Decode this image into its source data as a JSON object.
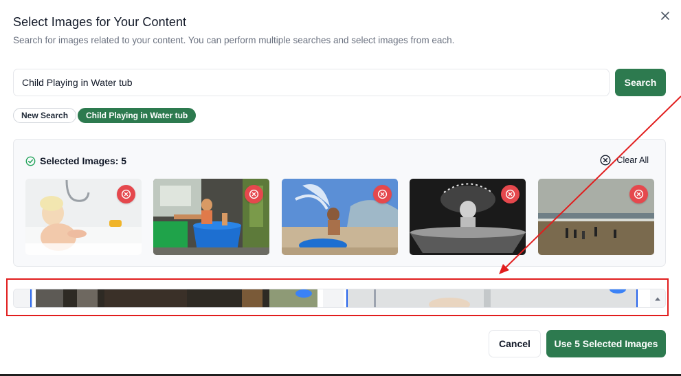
{
  "dialog": {
    "title": "Select Images for Your Content",
    "subtitle": "Search for images related to your content. You can perform multiple searches and select images from each.",
    "close_icon": "close-icon"
  },
  "search": {
    "value": "Child Playing in Water tub",
    "button_label": "Search"
  },
  "chips": {
    "new_search": "New Search",
    "active_query": "Child Playing in Water tub"
  },
  "selected": {
    "title": "Selected Images: 5",
    "clear_all_label": "Clear All",
    "images": [
      {
        "icon": "remove-icon"
      },
      {
        "icon": "remove-icon"
      },
      {
        "icon": "remove-icon"
      },
      {
        "icon": "remove-icon"
      },
      {
        "icon": "remove-icon"
      }
    ]
  },
  "footer": {
    "cancel_label": "Cancel",
    "use_label": "Use 5 Selected Images"
  },
  "colors": {
    "accent": "#2d7a4f",
    "remove": "#e5484d",
    "annotation": "#e11d1d"
  }
}
